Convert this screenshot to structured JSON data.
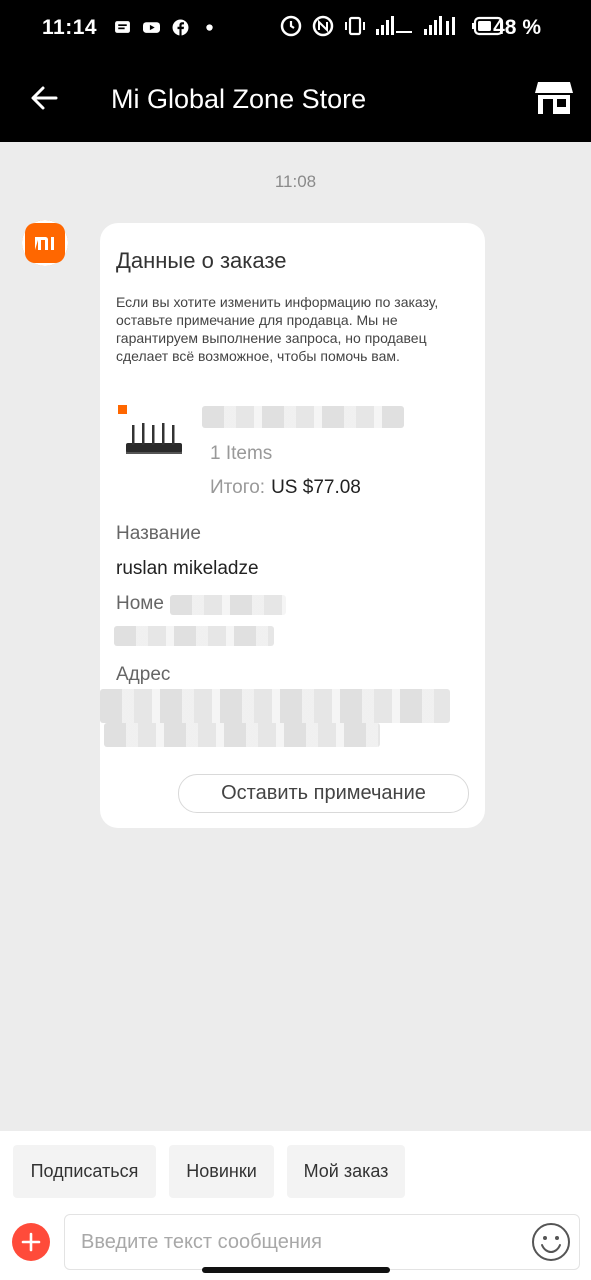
{
  "status_bar": {
    "time": "11:14",
    "battery": "48 %"
  },
  "header": {
    "title": "Mi Global Zone Store",
    "back_icon": "arrow-left-icon",
    "store_icon": "store-icon"
  },
  "chat": {
    "timestamp": "11:08",
    "avatar_text": "mi",
    "card": {
      "title": "Данные о заказе",
      "description": "Если вы хотите изменить информацию по заказу, оставьте примечание для продавца. Мы не гарантируем выполнение запроса, но продавец сделает всё возможное, чтобы помочь вам.",
      "items": "1 Items",
      "total_label": "Итого:",
      "total_amount": "US $77.08",
      "name_label": "Название",
      "name_value": "ruslan mikeladze",
      "phone_label": "Номе",
      "address_label": "Адрес",
      "note_button": "Оставить примечание"
    }
  },
  "quick_actions": [
    "Подписаться",
    "Новинки",
    "Мой заказ"
  ],
  "composer": {
    "placeholder": "Введите текст сообщения"
  },
  "colors": {
    "accent": "#ff6700",
    "plus_button": "#ff4b3a",
    "header_bg": "#000000",
    "chat_bg": "#ececec"
  }
}
